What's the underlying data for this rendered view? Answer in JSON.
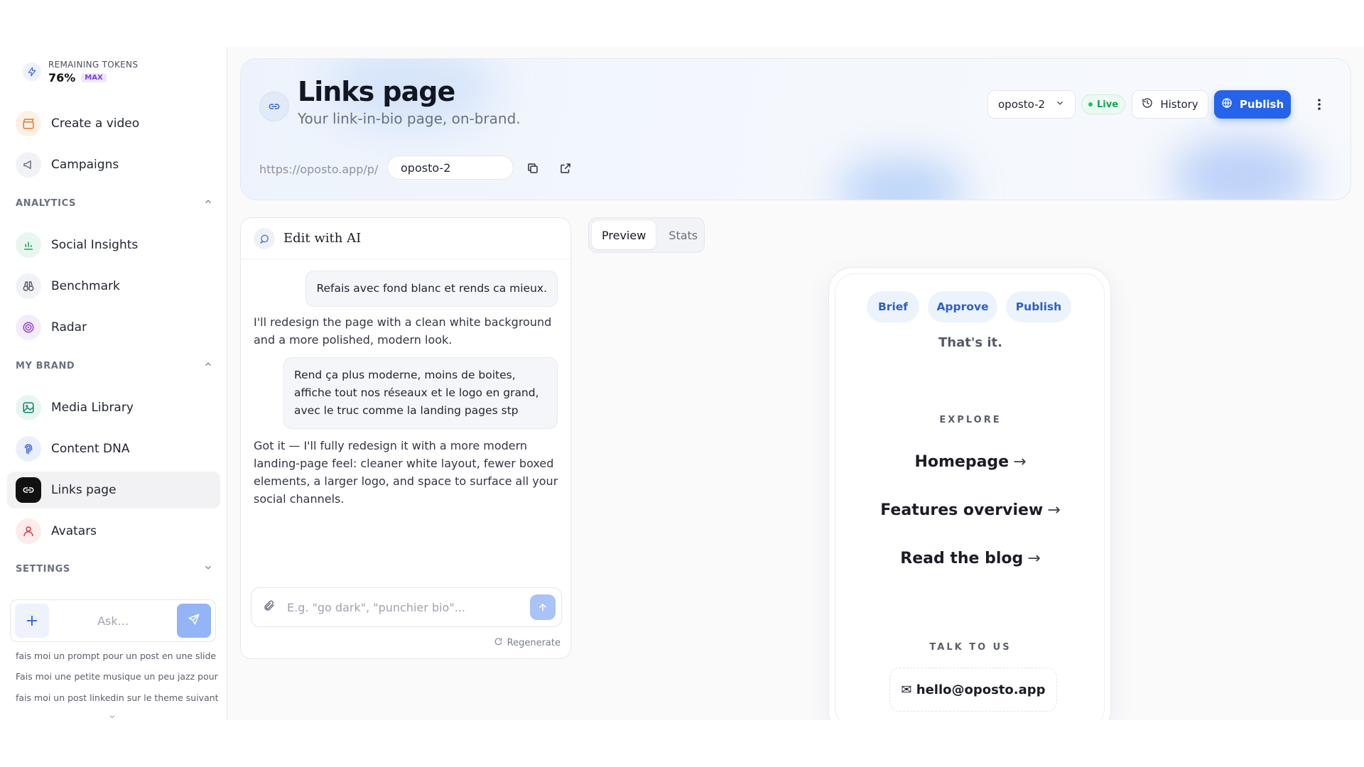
{
  "sidebar": {
    "tokens": {
      "label": "REMAINING TOKENS",
      "value": "76%",
      "badge": "MAX"
    },
    "items_top": [
      {
        "label": "Create a video",
        "icon": "clapperboard-icon"
      },
      {
        "label": "Campaigns",
        "icon": "megaphone-icon"
      }
    ],
    "analytics": {
      "title": "ANALYTICS",
      "items": [
        {
          "label": "Social Insights",
          "icon": "bar-chart-icon"
        },
        {
          "label": "Benchmark",
          "icon": "binoculars-icon"
        },
        {
          "label": "Radar",
          "icon": "radar-icon"
        }
      ]
    },
    "my_brand": {
      "title": "MY BRAND",
      "items": [
        {
          "label": "Media Library",
          "icon": "image-icon"
        },
        {
          "label": "Content DNA",
          "icon": "fingerprint-icon"
        },
        {
          "label": "Links page",
          "icon": "link-icon",
          "active": true
        },
        {
          "label": "Avatars",
          "icon": "user-icon"
        }
      ]
    },
    "settings": {
      "title": "SETTINGS"
    },
    "ask": {
      "placeholder": "Ask...",
      "plus": "+"
    },
    "history": [
      "fais moi un prompt pour un post en une slide qui a...",
      "Fais moi une petite musique un peu jazz pour prése",
      "fais moi un post linkedin sur le theme suivant : A..."
    ]
  },
  "header": {
    "title": "Links page",
    "subtitle": "Your link-in-bio page, on-brand.",
    "url_prefix": "https://oposto.app/p/",
    "slug": "oposto-2",
    "project": "oposto-2",
    "status": "Live",
    "history_label": "History",
    "publish_label": "Publish"
  },
  "ai_panel": {
    "title": "Edit with AI",
    "messages": [
      {
        "role": "user",
        "text": "Refais avec fond blanc et rends ca mieux."
      },
      {
        "role": "assistant",
        "text": "I'll redesign the page with a clean white background and a more polished, modern look."
      },
      {
        "role": "user",
        "text": "Rend ça plus moderne, moins de boites, affiche tout nos réseaux et le logo en grand, avec le truc comme la landing pages stp"
      },
      {
        "role": "assistant",
        "text": "Got it — I'll fully redesign it with a more modern landing-page feel: cleaner white layout, fewer boxed elements, a larger logo, and space to surface all your social channels."
      }
    ],
    "input_placeholder": "E.g. \"go dark\", \"punchier bio\"...",
    "regenerate_label": "Regenerate"
  },
  "tabs": [
    {
      "label": "Preview",
      "active": true
    },
    {
      "label": "Stats",
      "active": false
    }
  ],
  "preview": {
    "chips": [
      "Brief",
      "Approve",
      "Publish"
    ],
    "tagline": "That's it.",
    "explore_title": "EXPLORE",
    "links": [
      "Homepage",
      "Features overview",
      "Read the blog"
    ],
    "arrow": "→",
    "talk_title": "TALK TO US",
    "email": "✉ hello@oposto.app"
  },
  "colors": {
    "accent": "#2563eb",
    "live": "#22c55e",
    "active_nav": "#111111"
  }
}
